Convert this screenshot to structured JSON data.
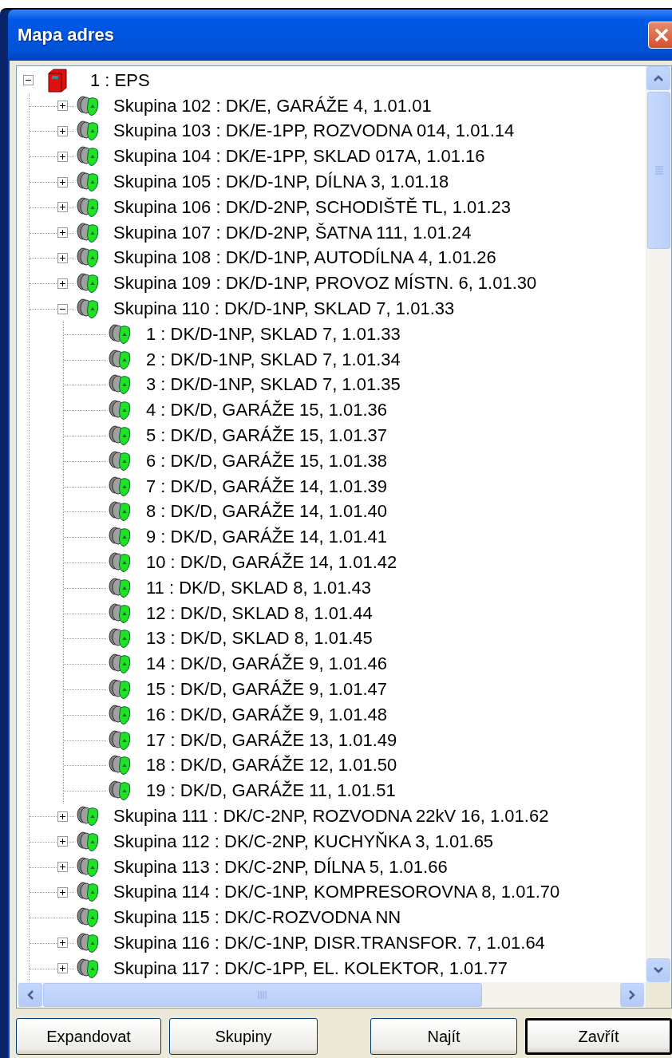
{
  "window": {
    "title": "Mapa adres"
  },
  "tree": {
    "nodes": [
      {
        "label": "1 : EPS",
        "kind": "panel",
        "expanded": true,
        "children": [
          {
            "label": "Skupina 102 : DK/E, GARÁŽE 4, 1.01.01",
            "kind": "group",
            "expanded": false
          },
          {
            "label": "Skupina 103 : DK/E-1PP, ROZVODNA 014, 1.01.14",
            "kind": "group",
            "expanded": false
          },
          {
            "label": "Skupina 104 : DK/E-1PP, SKLAD 017A, 1.01.16",
            "kind": "group",
            "expanded": false
          },
          {
            "label": "Skupina 105 : DK/D-1NP, DÍLNA 3, 1.01.18",
            "kind": "group",
            "expanded": false
          },
          {
            "label": "Skupina 106 : DK/D-2NP, SCHODIŠTĚ TL, 1.01.23",
            "kind": "group",
            "expanded": false
          },
          {
            "label": "Skupina 107 : DK/D-2NP, ŠATNA 111, 1.01.24",
            "kind": "group",
            "expanded": false
          },
          {
            "label": "Skupina 108 : DK/D-1NP, AUTODÍLNA 4, 1.01.26",
            "kind": "group",
            "expanded": false
          },
          {
            "label": "Skupina 109 : DK/D-1NP, PROVOZ MÍSTN. 6, 1.01.30",
            "kind": "group",
            "expanded": false
          },
          {
            "label": "Skupina 110 : DK/D-1NP, SKLAD 7, 1.01.33",
            "kind": "group",
            "expanded": true,
            "children": [
              {
                "label": "1 : DK/D-1NP, SKLAD 7, 1.01.33",
                "kind": "detector"
              },
              {
                "label": "2 : DK/D-1NP, SKLAD 7, 1.01.34",
                "kind": "detector"
              },
              {
                "label": "3 : DK/D-1NP, SKLAD 7, 1.01.35",
                "kind": "detector"
              },
              {
                "label": "4 : DK/D, GARÁŽE 15, 1.01.36",
                "kind": "detector"
              },
              {
                "label": "5 : DK/D, GARÁŽE 15, 1.01.37",
                "kind": "detector"
              },
              {
                "label": "6 : DK/D, GARÁŽE 15, 1.01.38",
                "kind": "detector"
              },
              {
                "label": "7 : DK/D, GARÁŽE 14, 1.01.39",
                "kind": "detector"
              },
              {
                "label": "8 : DK/D, GARÁŽE 14, 1.01.40",
                "kind": "detector"
              },
              {
                "label": "9 : DK/D, GARÁŽE 14, 1.01.41",
                "kind": "detector"
              },
              {
                "label": "10 : DK/D, GARÁŽE 14, 1.01.42",
                "kind": "detector"
              },
              {
                "label": "11 : DK/D, SKLAD 8, 1.01.43",
                "kind": "detector"
              },
              {
                "label": "12 : DK/D, SKLAD 8, 1.01.44",
                "kind": "detector"
              },
              {
                "label": "13 : DK/D, SKLAD 8, 1.01.45",
                "kind": "detector"
              },
              {
                "label": "14 : DK/D, GARÁŽE 9, 1.01.46",
                "kind": "detector"
              },
              {
                "label": "15 : DK/D, GARÁŽE 9, 1.01.47",
                "kind": "detector"
              },
              {
                "label": "16 : DK/D, GARÁŽE 9, 1.01.48",
                "kind": "detector"
              },
              {
                "label": "17 : DK/D, GARÁŽE 13, 1.01.49",
                "kind": "detector"
              },
              {
                "label": "18 : DK/D, GARÁŽE 12, 1.01.50",
                "kind": "detector"
              },
              {
                "label": "19 : DK/D, GARÁŽE 11, 1.01.51",
                "kind": "detector"
              }
            ]
          },
          {
            "label": "Skupina 111 : DK/C-2NP, ROZVODNA 22kV 16, 1.01.62",
            "kind": "group",
            "expanded": false
          },
          {
            "label": "Skupina 112 : DK/C-2NP, KUCHYŇKA 3, 1.01.65",
            "kind": "group",
            "expanded": false
          },
          {
            "label": "Skupina 113 : DK/C-2NP, DÍLNA 5, 1.01.66",
            "kind": "group",
            "expanded": false
          },
          {
            "label": "Skupina 114 : DK/C-1NP, KOMPRESOROVNA 8, 1.01.70",
            "kind": "group",
            "expanded": false
          },
          {
            "label": "Skupina 115 : DK/C-ROZVODNA NN",
            "kind": "group"
          },
          {
            "label": "Skupina 116 : DK/C-1NP, DISR.TRANSFOR. 7, 1.01.64",
            "kind": "group",
            "expanded": false
          },
          {
            "label": "Skupina 117 : DK/C-1PP, EL. KOLEKTOR, 1.01.77",
            "kind": "group",
            "expanded": false
          }
        ]
      }
    ]
  },
  "buttons": [
    {
      "label": "Expandovat",
      "default": false
    },
    {
      "label": "Skupiny",
      "default": false
    },
    {
      "label": "Najít",
      "default": false
    },
    {
      "label": "Zavřít",
      "default": true
    }
  ]
}
